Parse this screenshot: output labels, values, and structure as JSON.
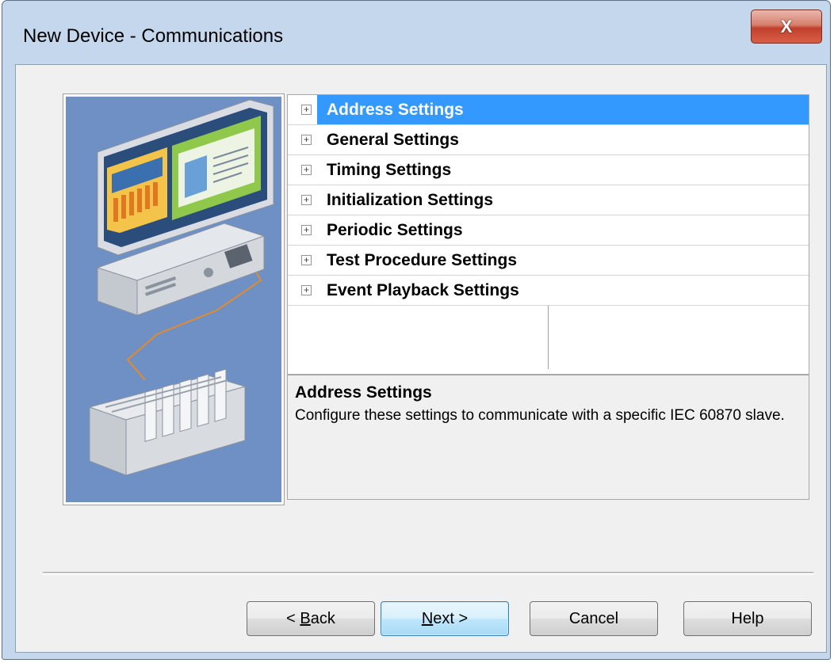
{
  "window": {
    "title": "New Device - Communications",
    "close_label": "X"
  },
  "tree": {
    "items": [
      {
        "label": "Address Settings",
        "selected": true
      },
      {
        "label": "General Settings",
        "selected": false
      },
      {
        "label": "Timing Settings",
        "selected": false
      },
      {
        "label": "Initialization Settings",
        "selected": false
      },
      {
        "label": "Periodic Settings",
        "selected": false
      },
      {
        "label": "Test Procedure Settings",
        "selected": false
      },
      {
        "label": "Event Playback Settings",
        "selected": false
      }
    ],
    "expander_glyph": "+"
  },
  "description": {
    "title": "Address Settings",
    "text": "Configure these settings to communicate with a specific IEC 60870 slave."
  },
  "buttons": {
    "back": {
      "prefix": "< ",
      "accel": "B",
      "rest": "ack"
    },
    "next": {
      "accel": "N",
      "rest": "ext >"
    },
    "cancel": "Cancel",
    "help": "Help"
  },
  "colors": {
    "selection": "#3399ff",
    "illustration_bg": "#6f90c4",
    "close_button": "#c2402c"
  },
  "icons": {
    "illustration": "computer-and-plc-illustration",
    "close": "close-icon"
  }
}
